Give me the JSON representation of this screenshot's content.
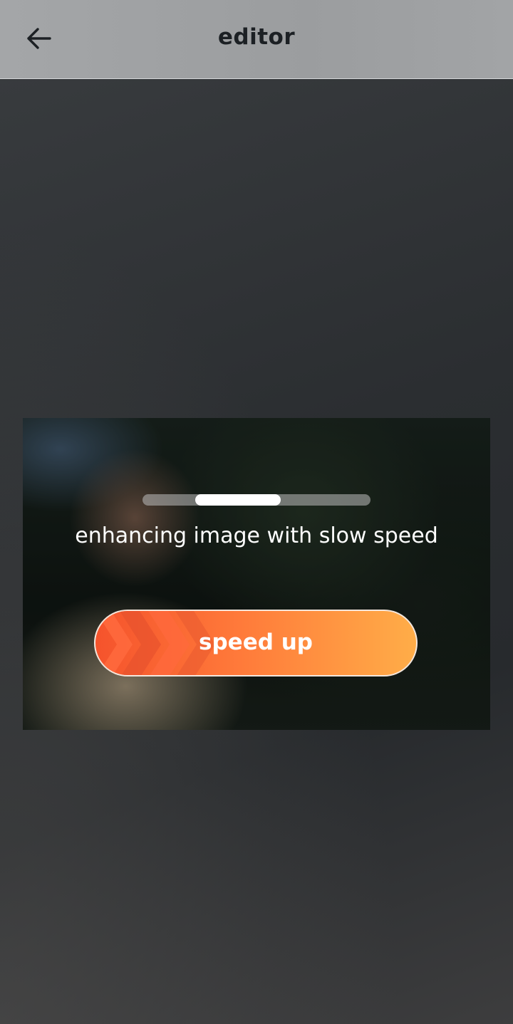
{
  "header": {
    "title": "editor",
    "back_icon": "arrow-left-icon"
  },
  "processing": {
    "progress_fraction": 0.375,
    "progress_start_fraction": 0.23,
    "status_text": "enhancing image with slow speed",
    "speed_up_label": "speed up",
    "speed_up_icon": "chevrons-right-icon"
  },
  "colors": {
    "header_bg": "#a0a2a4",
    "button_gradient_start": "#f5532c",
    "button_gradient_end": "#ffad48",
    "text_light": "#ffffff",
    "text_dark": "#1c2024"
  }
}
